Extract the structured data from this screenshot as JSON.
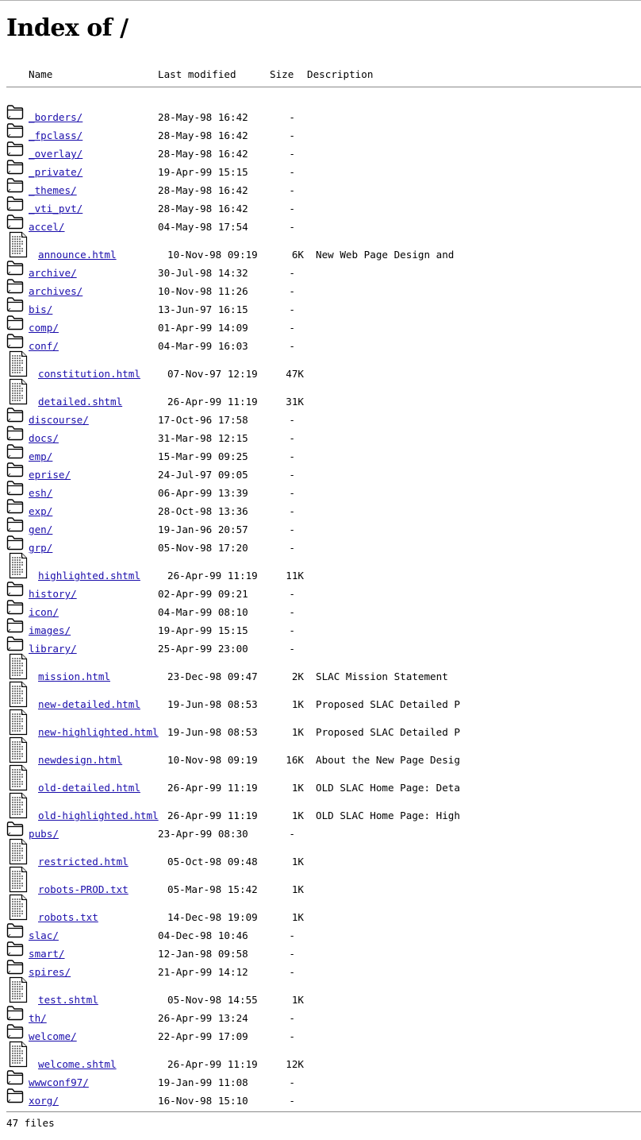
{
  "page": {
    "title": "Index of /",
    "footer": "47 files"
  },
  "header": {
    "name": "Name",
    "last_modified": "Last modified",
    "size": "Size",
    "description": "Description"
  },
  "entries": [
    {
      "type": "dir",
      "name": "_borders/",
      "date": "28-May-98 16:42",
      "size": "-",
      "desc": ""
    },
    {
      "type": "dir",
      "name": "_fpclass/",
      "date": "28-May-98 16:42",
      "size": "-",
      "desc": ""
    },
    {
      "type": "dir",
      "name": "_overlay/",
      "date": "28-May-98 16:42",
      "size": "-",
      "desc": ""
    },
    {
      "type": "dir",
      "name": "_private/",
      "date": "19-Apr-99 15:15",
      "size": "-",
      "desc": ""
    },
    {
      "type": "dir",
      "name": "_themes/",
      "date": "28-May-98 16:42",
      "size": "-",
      "desc": ""
    },
    {
      "type": "dir",
      "name": "_vti_pvt/",
      "date": "28-May-98 16:42",
      "size": "-",
      "desc": ""
    },
    {
      "type": "dir",
      "name": "accel/",
      "date": "04-May-98 17:54",
      "size": "-",
      "desc": ""
    },
    {
      "type": "file",
      "name": "announce.html",
      "date": "10-Nov-98 09:19",
      "size": "6K",
      "desc": "New Web Page Design and"
    },
    {
      "type": "dir",
      "name": "archive/",
      "date": "30-Jul-98 14:32",
      "size": "-",
      "desc": ""
    },
    {
      "type": "dir",
      "name": "archives/",
      "date": "10-Nov-98 11:26",
      "size": "-",
      "desc": ""
    },
    {
      "type": "dir",
      "name": "bis/",
      "date": "13-Jun-97 16:15",
      "size": "-",
      "desc": ""
    },
    {
      "type": "dir",
      "name": "comp/",
      "date": "01-Apr-99 14:09",
      "size": "-",
      "desc": ""
    },
    {
      "type": "dir",
      "name": "conf/",
      "date": "04-Mar-99 16:03",
      "size": "-",
      "desc": ""
    },
    {
      "type": "file",
      "name": "constitution.html",
      "date": "07-Nov-97 12:19",
      "size": "47K",
      "desc": ""
    },
    {
      "type": "file",
      "name": "detailed.shtml",
      "date": "26-Apr-99 11:19",
      "size": "31K",
      "desc": ""
    },
    {
      "type": "dir",
      "name": "discourse/",
      "date": "17-Oct-96 17:58",
      "size": "-",
      "desc": ""
    },
    {
      "type": "dir",
      "name": "docs/",
      "date": "31-Mar-98 12:15",
      "size": "-",
      "desc": ""
    },
    {
      "type": "dir",
      "name": "emp/",
      "date": "15-Mar-99 09:25",
      "size": "-",
      "desc": ""
    },
    {
      "type": "dir",
      "name": "eprise/",
      "date": "24-Jul-97 09:05",
      "size": "-",
      "desc": ""
    },
    {
      "type": "dir",
      "name": "esh/",
      "date": "06-Apr-99 13:39",
      "size": "-",
      "desc": ""
    },
    {
      "type": "dir",
      "name": "exp/",
      "date": "28-Oct-98 13:36",
      "size": "-",
      "desc": ""
    },
    {
      "type": "dir",
      "name": "gen/",
      "date": "19-Jan-96 20:57",
      "size": "-",
      "desc": ""
    },
    {
      "type": "dir",
      "name": "grp/",
      "date": "05-Nov-98 17:20",
      "size": "-",
      "desc": ""
    },
    {
      "type": "file",
      "name": "highlighted.shtml",
      "date": "26-Apr-99 11:19",
      "size": "11K",
      "desc": ""
    },
    {
      "type": "dir",
      "name": "history/",
      "date": "02-Apr-99 09:21",
      "size": "-",
      "desc": ""
    },
    {
      "type": "dir",
      "name": "icon/",
      "date": "04-Mar-99 08:10",
      "size": "-",
      "desc": ""
    },
    {
      "type": "dir",
      "name": "images/",
      "date": "19-Apr-99 15:15",
      "size": "-",
      "desc": ""
    },
    {
      "type": "dir",
      "name": "library/",
      "date": "25-Apr-99 23:00",
      "size": "-",
      "desc": ""
    },
    {
      "type": "file",
      "name": "mission.html",
      "date": "23-Dec-98 09:47",
      "size": "2K",
      "desc": "SLAC Mission Statement"
    },
    {
      "type": "file",
      "name": "new-detailed.html",
      "date": "19-Jun-98 08:53",
      "size": "1K",
      "desc": "Proposed SLAC Detailed P"
    },
    {
      "type": "file",
      "name": "new-highlighted.html",
      "date": "19-Jun-98 08:53",
      "size": "1K",
      "desc": "Proposed SLAC Detailed P"
    },
    {
      "type": "file",
      "name": "newdesign.html",
      "date": "10-Nov-98 09:19",
      "size": "16K",
      "desc": "About the New Page Desig"
    },
    {
      "type": "file",
      "name": "old-detailed.html",
      "date": "26-Apr-99 11:19",
      "size": "1K",
      "desc": "OLD SLAC Home Page: Deta"
    },
    {
      "type": "file",
      "name": "old-highlighted.html",
      "date": "26-Apr-99 11:19",
      "size": "1K",
      "desc": "OLD SLAC Home Page: High"
    },
    {
      "type": "dir",
      "name": "pubs/",
      "date": "23-Apr-99 08:30",
      "size": "-",
      "desc": ""
    },
    {
      "type": "file",
      "name": "restricted.html",
      "date": "05-Oct-98 09:48",
      "size": "1K",
      "desc": ""
    },
    {
      "type": "file",
      "name": "robots-PROD.txt",
      "date": "05-Mar-98 15:42",
      "size": "1K",
      "desc": ""
    },
    {
      "type": "file",
      "name": "robots.txt",
      "date": "14-Dec-98 19:09",
      "size": "1K",
      "desc": ""
    },
    {
      "type": "dir",
      "name": "slac/",
      "date": "04-Dec-98 10:46",
      "size": "-",
      "desc": ""
    },
    {
      "type": "dir",
      "name": "smart/",
      "date": "12-Jan-98 09:58",
      "size": "-",
      "desc": ""
    },
    {
      "type": "dir",
      "name": "spires/",
      "date": "21-Apr-99 14:12",
      "size": "-",
      "desc": ""
    },
    {
      "type": "file",
      "name": "test.shtml",
      "date": "05-Nov-98 14:55",
      "size": "1K",
      "desc": ""
    },
    {
      "type": "dir",
      "name": "th/",
      "date": "26-Apr-99 13:24",
      "size": "-",
      "desc": ""
    },
    {
      "type": "dir",
      "name": "welcome/",
      "date": "22-Apr-99 17:09",
      "size": "-",
      "desc": ""
    },
    {
      "type": "file",
      "name": "welcome.shtml",
      "date": "26-Apr-99 11:19",
      "size": "12K",
      "desc": ""
    },
    {
      "type": "dir",
      "name": "wwwconf97/",
      "date": "19-Jan-99 11:08",
      "size": "-",
      "desc": ""
    },
    {
      "type": "dir",
      "name": "xorg/",
      "date": "16-Nov-98 15:10",
      "size": "-",
      "desc": ""
    }
  ]
}
